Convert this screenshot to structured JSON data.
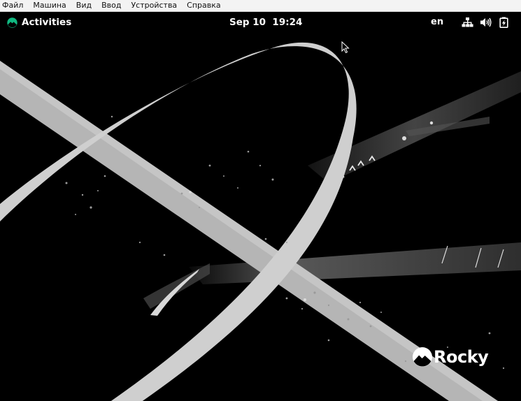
{
  "vm_menu": {
    "items": [
      {
        "label": "Файл"
      },
      {
        "label": "Машина"
      },
      {
        "label": "Вид"
      },
      {
        "label": "Ввод"
      },
      {
        "label": "Устройства"
      },
      {
        "label": "Справка"
      }
    ]
  },
  "topbar": {
    "activities_label": "Activities",
    "clock": "Sep 10  19:24",
    "input_language": "en",
    "status_icons": [
      "network-icon",
      "volume-icon",
      "battery-icon"
    ]
  },
  "wallpaper": {
    "brand_text": "Rocky",
    "accent_color": "#10b981"
  }
}
